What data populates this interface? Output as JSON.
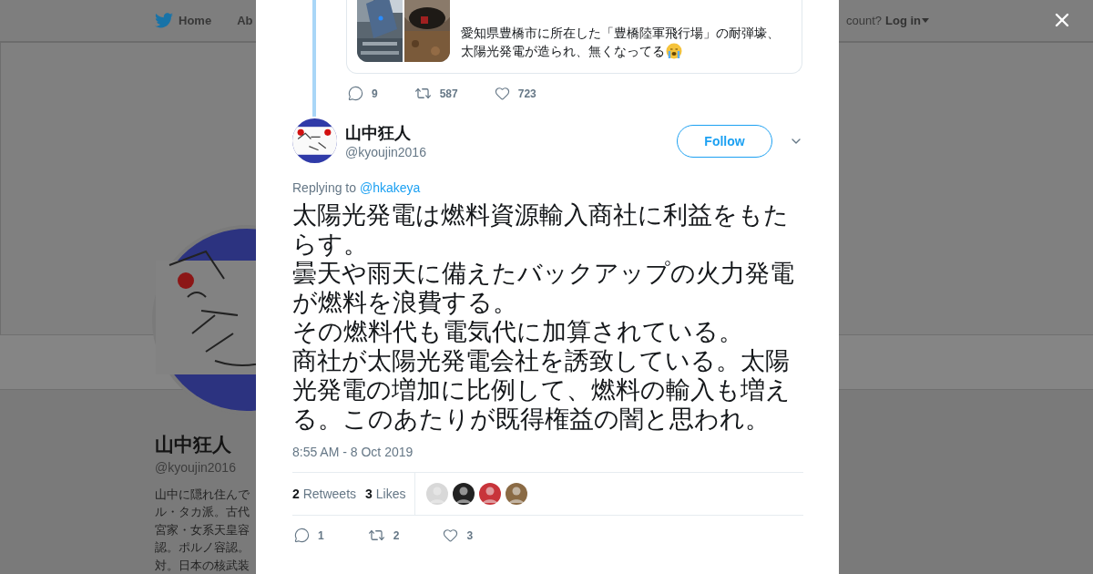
{
  "nav": {
    "items": [
      {
        "label": "Home"
      },
      {
        "label": "Ab"
      }
    ],
    "account_prompt": "count?",
    "login": "Log in"
  },
  "profile": {
    "name": "山中狂人",
    "handle": "@kyoujin2016",
    "bio_lines": [
      "山中に隠れ住んで",
      "ル・タカ派。古代",
      "宮家・女系天皇容",
      "認。ポルノ容認。",
      "対。日本の核武装"
    ]
  },
  "quoted_tweet": {
    "lines": [
      "愛知県豊橋市に所在した「豊橋陸軍飛行場」の耐弾壕、",
      "太陽光発電が造られ、無くなってる"
    ],
    "replies": "9",
    "retweets": "587",
    "likes": "723"
  },
  "tweet": {
    "name": "山中狂人",
    "handle": "@kyoujin2016",
    "follow": "Follow",
    "replying_label": "Replying to",
    "replying_to": "@hkakeya",
    "paragraphs": [
      "太陽光発電は燃料資源輸入商社に利益をもたらす。",
      "曇天や雨天に備えたバックアップの火力発電が燃料を浪費する。",
      "その燃料代も電気代に加算されている。",
      "商社が太陽光発電会社を誘致している。太陽光発電の増加に比例して、燃料の輸入も増える。このあたりが既得権益の闇と思われ。"
    ],
    "timestamp": "8:55 AM - 8 Oct 2019",
    "retweet_count": "2",
    "retweet_label": "Retweets",
    "like_count": "3",
    "like_label": "Likes",
    "liker_avatars": [
      {
        "color": "#d8d8d8"
      },
      {
        "color": "#222222"
      },
      {
        "color": "#c8343a"
      },
      {
        "color": "#8a6a44"
      }
    ],
    "replies": "1",
    "retweets": "2",
    "likes": "3"
  }
}
